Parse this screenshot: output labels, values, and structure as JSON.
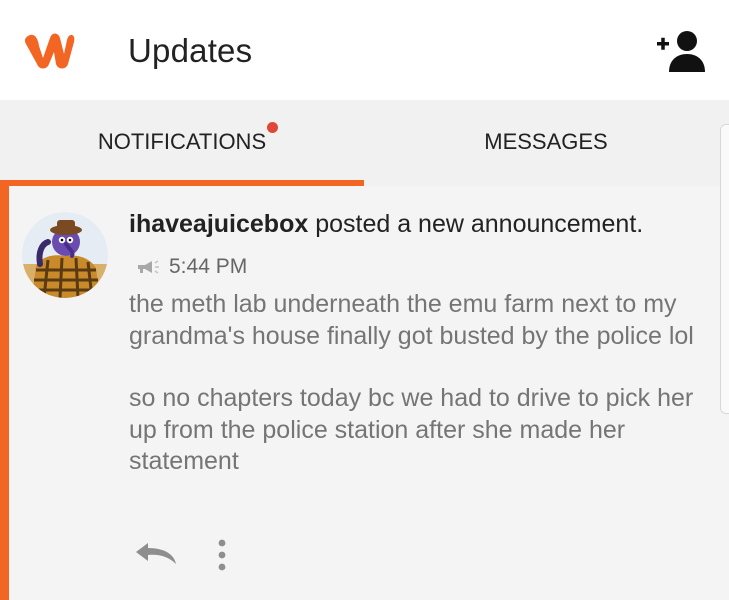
{
  "app_bar": {
    "title": "Updates",
    "logo_icon": "wattpad-logo-icon",
    "action_icon": "add-user-icon",
    "brand_color": "#f26522"
  },
  "tabs": [
    {
      "label": "NOTIFICATIONS",
      "selected": true,
      "has_unread_dot": true
    },
    {
      "label": "MESSAGES",
      "selected": false,
      "has_unread_dot": false
    }
  ],
  "notification": {
    "username": "ihaveajuicebox",
    "action_text": " posted a new announcement.",
    "type_icon": "megaphone-icon",
    "time": "5:44 PM",
    "paragraphs": [
      "the meth lab underneath the emu farm next to my grandma's house finally got busted by the police lol",
      "so no chapters today bc we had to drive to pick her up from the police station after she made her statement"
    ],
    "actions": [
      "reply-icon",
      "more-vert-icon"
    ]
  },
  "colors": {
    "accent": "#f26522",
    "unread_dot": "#e0473a",
    "body_text": "#757575",
    "title_text": "#222222"
  }
}
